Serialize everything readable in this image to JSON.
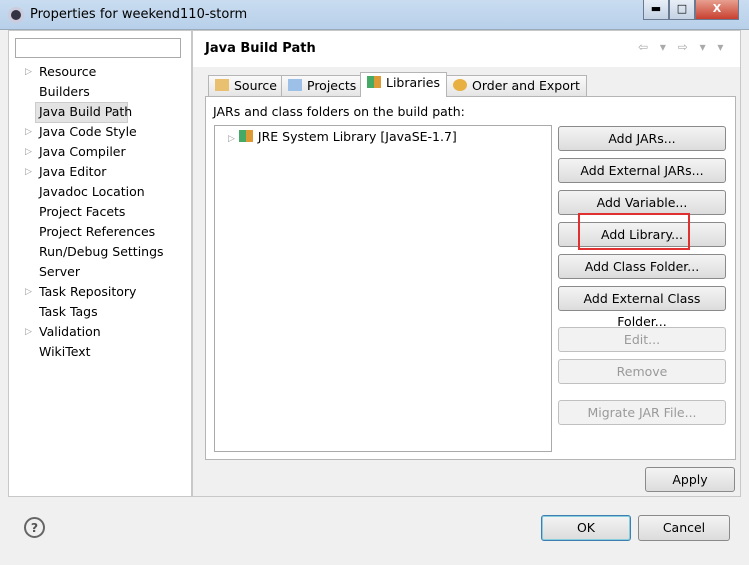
{
  "window": {
    "title": "Properties for weekend110-storm",
    "minimize": "▬",
    "maximize": "□",
    "close": "X"
  },
  "sidebar": {
    "filter_placeholder": "",
    "items": [
      {
        "label": "Resource",
        "expandable": true
      },
      {
        "label": "Builders",
        "expandable": false
      },
      {
        "label": "Java Build Path",
        "expandable": false,
        "selected": true
      },
      {
        "label": "Java Code Style",
        "expandable": true
      },
      {
        "label": "Java Compiler",
        "expandable": true
      },
      {
        "label": "Java Editor",
        "expandable": true
      },
      {
        "label": "Javadoc Location",
        "expandable": false
      },
      {
        "label": "Project Facets",
        "expandable": false
      },
      {
        "label": "Project References",
        "expandable": false
      },
      {
        "label": "Run/Debug Settings",
        "expandable": false
      },
      {
        "label": "Server",
        "expandable": false
      },
      {
        "label": "Task Repository",
        "expandable": true
      },
      {
        "label": "Task Tags",
        "expandable": false
      },
      {
        "label": "Validation",
        "expandable": true
      },
      {
        "label": "WikiText",
        "expandable": false
      }
    ]
  },
  "page": {
    "title": "Java Build Path",
    "nav": "⇦ ▾ ⇨ ▾ ▾",
    "tabs": [
      {
        "label": "Source"
      },
      {
        "label": "Projects"
      },
      {
        "label": "Libraries",
        "active": true
      },
      {
        "label": "Order and Export"
      }
    ],
    "list_label": "JARs and class folders on the build path:",
    "entries": [
      {
        "label": "JRE System Library [JavaSE-1.7]"
      }
    ],
    "buttons": [
      {
        "label": "Add JARs...",
        "enabled": true
      },
      {
        "label": "Add External JARs...",
        "enabled": true
      },
      {
        "label": "Add Variable...",
        "enabled": true
      },
      {
        "label": "Add Library...",
        "enabled": true,
        "highlighted": true
      },
      {
        "label": "Add Class Folder...",
        "enabled": true
      },
      {
        "label": "Add External Class Folder...",
        "enabled": true
      },
      {
        "label": "Edit...",
        "enabled": false
      },
      {
        "label": "Remove",
        "enabled": false
      },
      {
        "label": "Migrate JAR File...",
        "enabled": false
      }
    ],
    "apply": "Apply"
  },
  "footer": {
    "help": "?",
    "ok": "OK",
    "cancel": "Cancel"
  },
  "colors": {
    "highlight_box": "#e03030"
  }
}
